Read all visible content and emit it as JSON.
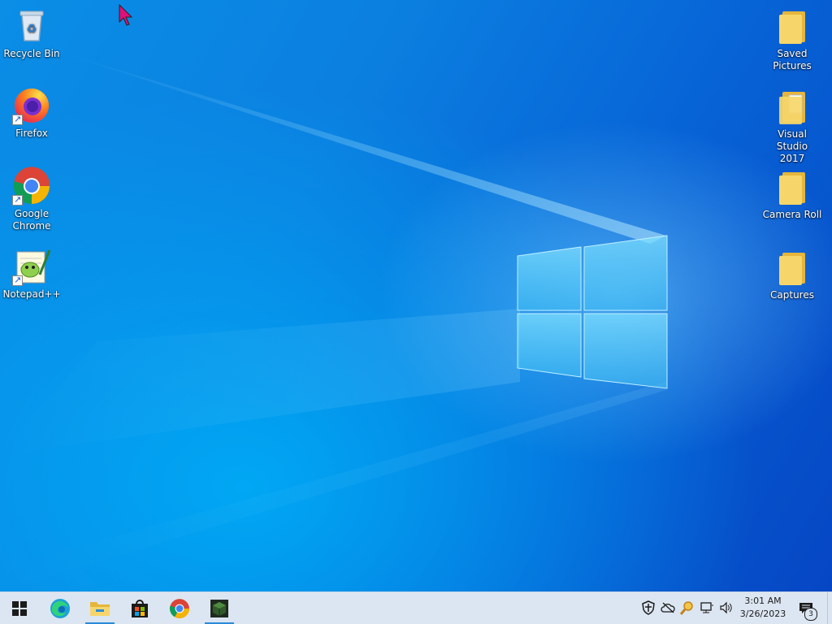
{
  "desktop": {
    "left_icons": [
      {
        "name": "recycle-bin",
        "label": "Recycle Bin"
      },
      {
        "name": "firefox",
        "label": "Firefox"
      },
      {
        "name": "google-chrome",
        "label": "Google\nChrome"
      },
      {
        "name": "notepad-plus-plus",
        "label": "Notepad++"
      }
    ],
    "right_icons": [
      {
        "name": "saved-pictures",
        "label": "Saved\nPictures"
      },
      {
        "name": "visual-studio-2017",
        "label": "Visual Studio\n2017"
      },
      {
        "name": "camera-roll",
        "label": "Camera Roll"
      },
      {
        "name": "captures",
        "label": "Captures"
      }
    ]
  },
  "taskbar": {
    "pinned": [
      {
        "icon": "windows-start-icon",
        "active": false
      },
      {
        "icon": "edge-icon",
        "active": false
      },
      {
        "icon": "file-explorer-icon",
        "active": true
      },
      {
        "icon": "microsoft-store-icon",
        "active": false
      },
      {
        "icon": "chrome-icon",
        "active": false
      },
      {
        "icon": "terminal-app-icon",
        "active": true
      }
    ],
    "tray_icons": [
      "security-shield-icon",
      "onedrive-offline-icon",
      "search-tool-icon",
      "network-icon",
      "volume-icon"
    ],
    "clock": {
      "time": "3:01 AM",
      "date": "3/26/2023"
    },
    "notifications": {
      "count": "3"
    }
  },
  "colors": {
    "taskbar_bg": "#dce6f2",
    "active_indicator": "#2b8ad9",
    "folder_yellow": "#f6d66a",
    "cursor_magenta": "#e0107a"
  }
}
